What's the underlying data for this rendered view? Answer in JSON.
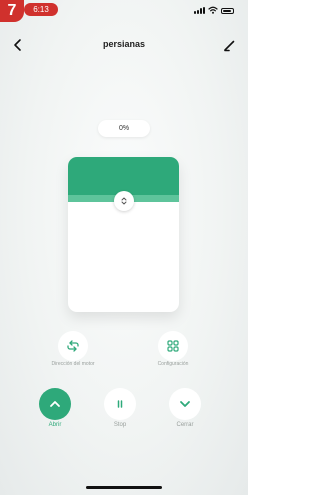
{
  "step_badge": "7",
  "status_bar": {
    "time": "6:13",
    "icons": [
      "signal-icon",
      "wifi-icon",
      "battery-icon"
    ]
  },
  "header": {
    "title": "persianas",
    "back_icon": "chevron-left-icon",
    "edit_icon": "pencil-icon"
  },
  "blind": {
    "position_label": "0%",
    "position_percent": 0,
    "handle_icon": "up-down-arrows-icon"
  },
  "secondary_actions": [
    {
      "label": "Dirección del motor",
      "icon": "reverse-icon"
    },
    {
      "label": "Configuración",
      "icon": "grid-icon"
    }
  ],
  "controls": [
    {
      "label": "Abrir",
      "icon": "chevron-up-icon",
      "active": true
    },
    {
      "label": "Stop",
      "icon": "pause-icon",
      "active": false
    },
    {
      "label": "Cerrar",
      "icon": "chevron-down-icon",
      "active": false
    }
  ],
  "colors": {
    "accent": "#2ea97a",
    "accent_light": "#5ec49b",
    "badge_red": "#d0312d",
    "label_gray": "#9aa09d"
  }
}
